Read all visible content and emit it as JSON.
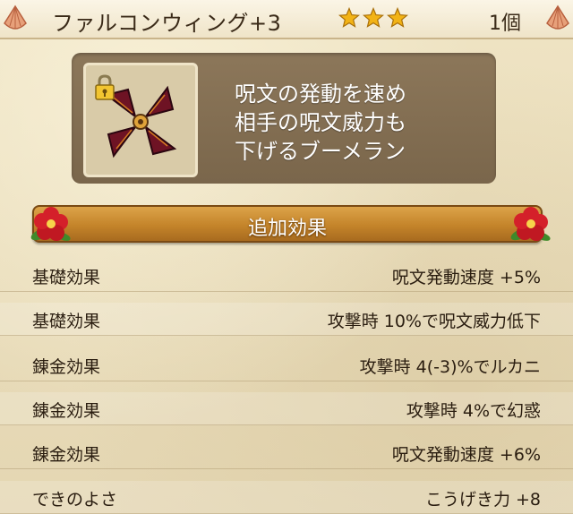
{
  "header": {
    "item_name": "ファルコンウィング+3",
    "star_count": 3,
    "quantity": "1個"
  },
  "item": {
    "icon": "boomerang-icon",
    "locked": true,
    "description_lines": [
      "呪文の発動を速め",
      "相手の呪文威力も",
      "下げるブーメラン"
    ]
  },
  "effects": {
    "title": "追加効果",
    "rows": [
      {
        "label": "基礎効果",
        "value": "呪文発動速度 +5%"
      },
      {
        "label": "基礎効果",
        "value": "攻撃時 10%で呪文威力低下"
      },
      {
        "label": "錬金効果",
        "value": "攻撃時 4(-3)%でルカニ"
      },
      {
        "label": "錬金効果",
        "value": "攻撃時 4%で幻惑"
      },
      {
        "label": "錬金効果",
        "value": "呪文発動速度 +6%"
      },
      {
        "label": "できのよさ",
        "value": "こうげき力 +8"
      }
    ]
  },
  "colors": {
    "star": "#f2b316",
    "banner": "#c4842a",
    "panel": "#7f6b50",
    "boomerang": "#6e1324"
  }
}
